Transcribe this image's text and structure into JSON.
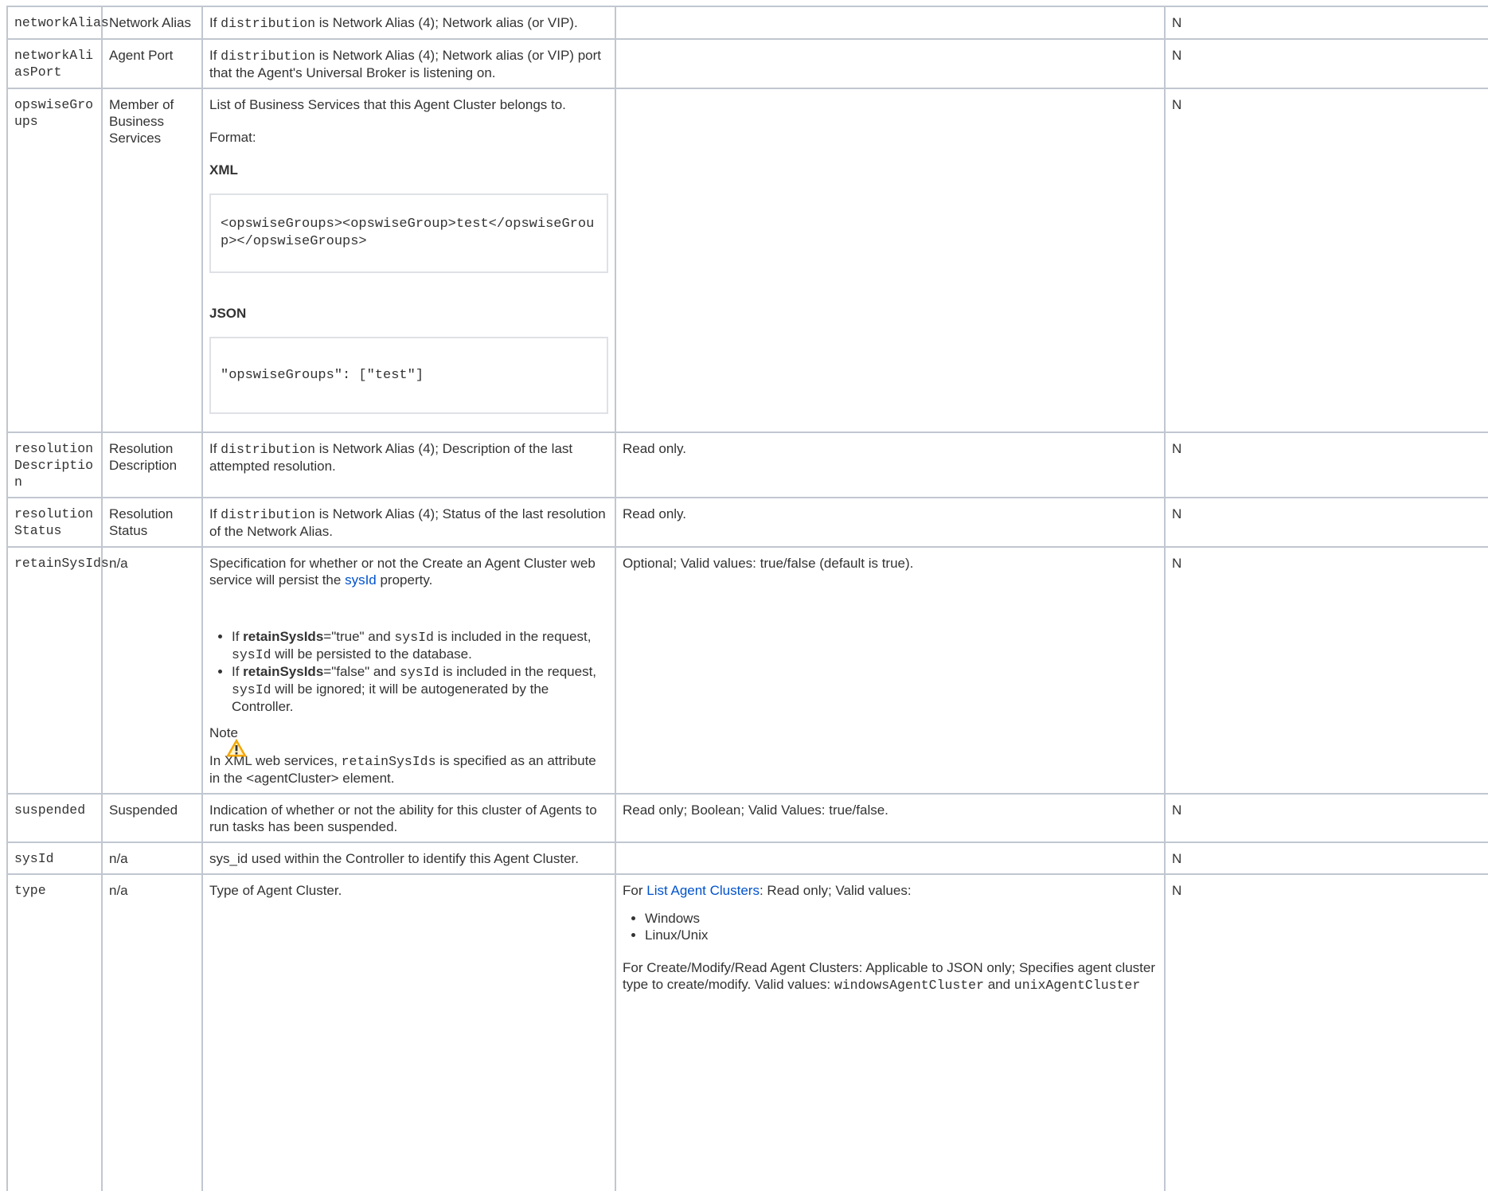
{
  "rows": [
    {
      "name": "networkAlias",
      "label": "Network Alias",
      "desc_pre": "If ",
      "desc_code": "distribution",
      "desc_post": " is Network Alias (4); Network alias (or VIP).",
      "spec": "",
      "req": "N"
    },
    {
      "name": "networkAliasPort",
      "label": "Agent Port",
      "desc_pre": "If ",
      "desc_code": "distribution",
      "desc_post": " is Network Alias (4); Network alias (or VIP) port that the Agent's Universal Broker is listening on.",
      "spec": "",
      "req": "N"
    },
    {
      "name": "opswiseGroups",
      "label": "Member of Business Services",
      "desc_intro": "List of Business Services that this Agent Cluster belongs to.",
      "format_label": "Format:",
      "xml_heading": "XML",
      "xml_code": "<opswiseGroups><opswiseGroup>test</opswiseGroup></opswiseGroups>",
      "json_heading": "JSON",
      "json_code": "\"opswiseGroups\": [\"test\"]",
      "spec": "",
      "req": "N"
    },
    {
      "name": "resolutionDescription",
      "label": "Resolution Description",
      "desc_pre": "If ",
      "desc_code": "distribution",
      "desc_post": " is Network Alias (4); Description of the last attempted resolution.",
      "spec": "Read only.",
      "req": "N"
    },
    {
      "name": "resolutionStatus",
      "label": "Resolution Status",
      "desc_pre": "If ",
      "desc_code": "distribution",
      "desc_post": " is Network Alias (4); Status of the last resolution of the Network Alias.",
      "spec": "Read only.",
      "req": "N"
    },
    {
      "name": "retainSysIds",
      "label": "n/a",
      "desc_intro_pre": "Specification for whether or not the Create an Agent Cluster web service will persist the ",
      "desc_link": "sysId",
      "desc_intro_post": " property.",
      "bullets": [
        {
          "pre": "If ",
          "bold": "retainSysIds",
          "mid": "=\"true\" and ",
          "code1": "sysId",
          "mid2": " is included in the request, ",
          "code2": "sysId",
          "post": " will be persisted to the database."
        },
        {
          "pre": "If ",
          "bold": "retainSysIds",
          "mid": "=\"false\" and ",
          "code1": "sysId",
          "mid2": " is included in the request, ",
          "code2": "sysId",
          "post": " will be ignored; it will be autogenerated by the Controller."
        }
      ],
      "note_title": "Note",
      "note_pre": "In XML web services, ",
      "note_code": "retainSysIds",
      "note_post": " is specified as an attribute in the <agentCluster> element.",
      "spec": "Optional; Valid values: true/false (default is true).",
      "req": "N"
    },
    {
      "name": "suspended",
      "label": "Suspended",
      "desc": "Indication of whether or not the ability for this cluster of Agents to run tasks has been suspended.",
      "spec": "Read only; Boolean; Valid Values: true/false.",
      "req": "N"
    },
    {
      "name": "sysId",
      "label": "n/a",
      "desc": "sys_id used within the Controller to identify this Agent Cluster.",
      "spec": "",
      "req": "N"
    },
    {
      "name": "type",
      "label": "n/a",
      "desc": "Type of Agent Cluster.",
      "spec_pre": "For ",
      "spec_link": "List Agent Clusters",
      "spec_post": ": Read only; Valid values:",
      "spec_values": [
        "Windows",
        "Linux/Unix"
      ],
      "spec2_pre": "For Create/Modify/Read Agent Clusters: Applicable to JSON only; Specifies agent cluster type to create/modify. Valid values: ",
      "spec2_code1": "windowsAgentCluster",
      "spec2_mid": " and ",
      "spec2_code2": "unixAgentCluster",
      "req": "N"
    }
  ]
}
